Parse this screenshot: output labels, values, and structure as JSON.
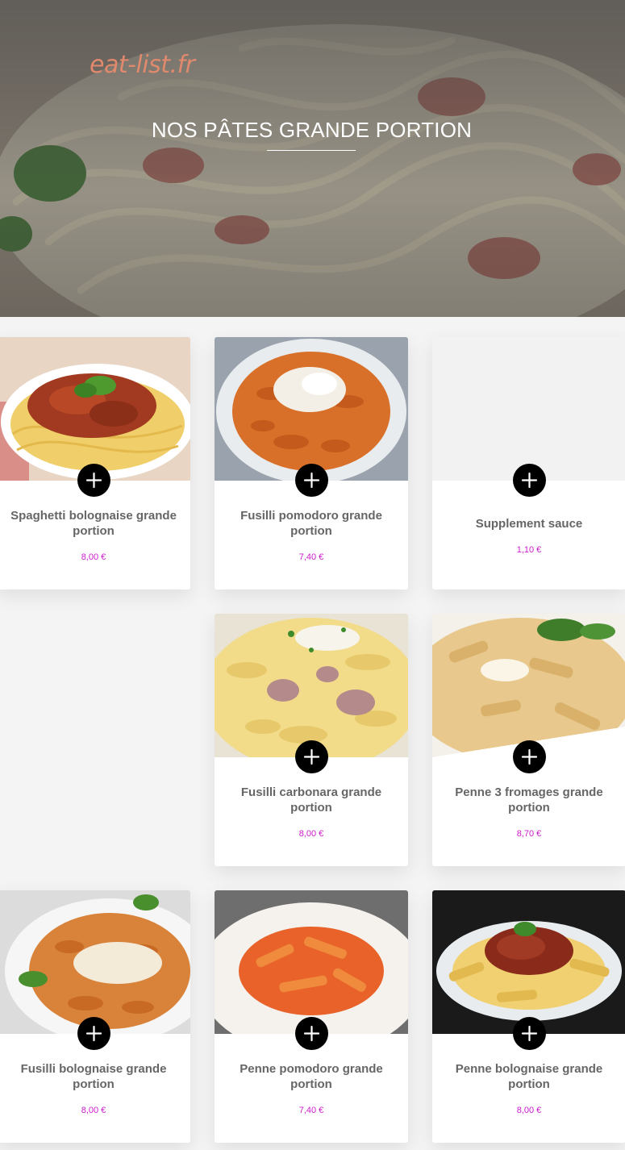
{
  "brand": "eat-list.fr",
  "header": {
    "title": "NOS PÂTES GRANDE PORTION"
  },
  "colors": {
    "accent_price": "#cc1bcc",
    "brand": "#e0896d",
    "button": "#000000"
  },
  "products": [
    {
      "name": "Spaghetti bolognaise grande portion",
      "price": "8,00 €",
      "image": "spaghetti-bolognaise"
    },
    {
      "name": "Fusilli pomodoro grande portion",
      "price": "7,40 €",
      "image": "fusilli-pomodoro"
    },
    {
      "name": "Supplement sauce",
      "price": "1,10 €",
      "image": "none"
    },
    {
      "name": "Fusilli carbonara grande portion",
      "price": "8,00 €",
      "image": "fusilli-carbonara"
    },
    {
      "name": "Penne 3 fromages grande portion",
      "price": "8,70 €",
      "image": "penne-3-fromages"
    },
    {
      "name": "Fusilli bolognaise grande portion",
      "price": "8,00 €",
      "image": "fusilli-bolognaise"
    },
    {
      "name": "Penne pomodoro grande portion",
      "price": "7,40 €",
      "image": "penne-pomodoro"
    },
    {
      "name": "Penne bolognaise grande portion",
      "price": "8,00 €",
      "image": "penne-bolognaise"
    }
  ],
  "add_button_icon": "plus-icon"
}
